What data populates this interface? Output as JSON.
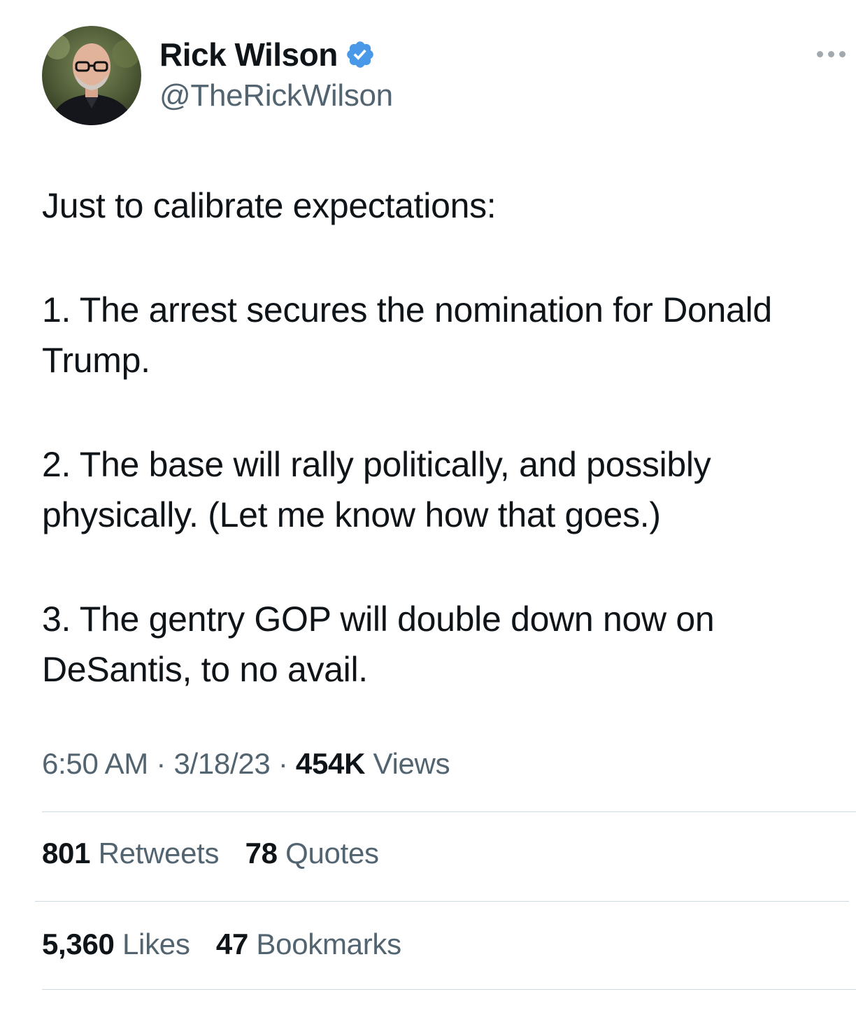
{
  "author": {
    "display_name": "Rick Wilson",
    "handle": "@TheRickWilson",
    "verified": true,
    "verified_color": "#4a99e9"
  },
  "tweet": {
    "paragraphs": [
      "Just to calibrate expectations:",
      "1. The arrest secures the nomination for Donald Trump.",
      "2. The base will rally politically, and possibly physically. (Let me know how that goes.)",
      "3. The gentry GOP will double down now on DeSantis, to no avail."
    ]
  },
  "meta": {
    "time": "6:50 AM",
    "separator": "·",
    "date": "3/18/23",
    "views_count": "454K",
    "views_label": "Views"
  },
  "stats": {
    "retweets_count": "801",
    "retweets_label": "Retweets",
    "quotes_count": "78",
    "quotes_label": "Quotes",
    "likes_count": "5,360",
    "likes_label": "Likes",
    "bookmarks_count": "47",
    "bookmarks_label": "Bookmarks"
  },
  "icons": {
    "verified": "verified-badge-icon",
    "more": "more-options-icon"
  },
  "colors": {
    "text_primary": "#0f1419",
    "text_secondary": "#536471",
    "divider": "#cfd9de"
  }
}
